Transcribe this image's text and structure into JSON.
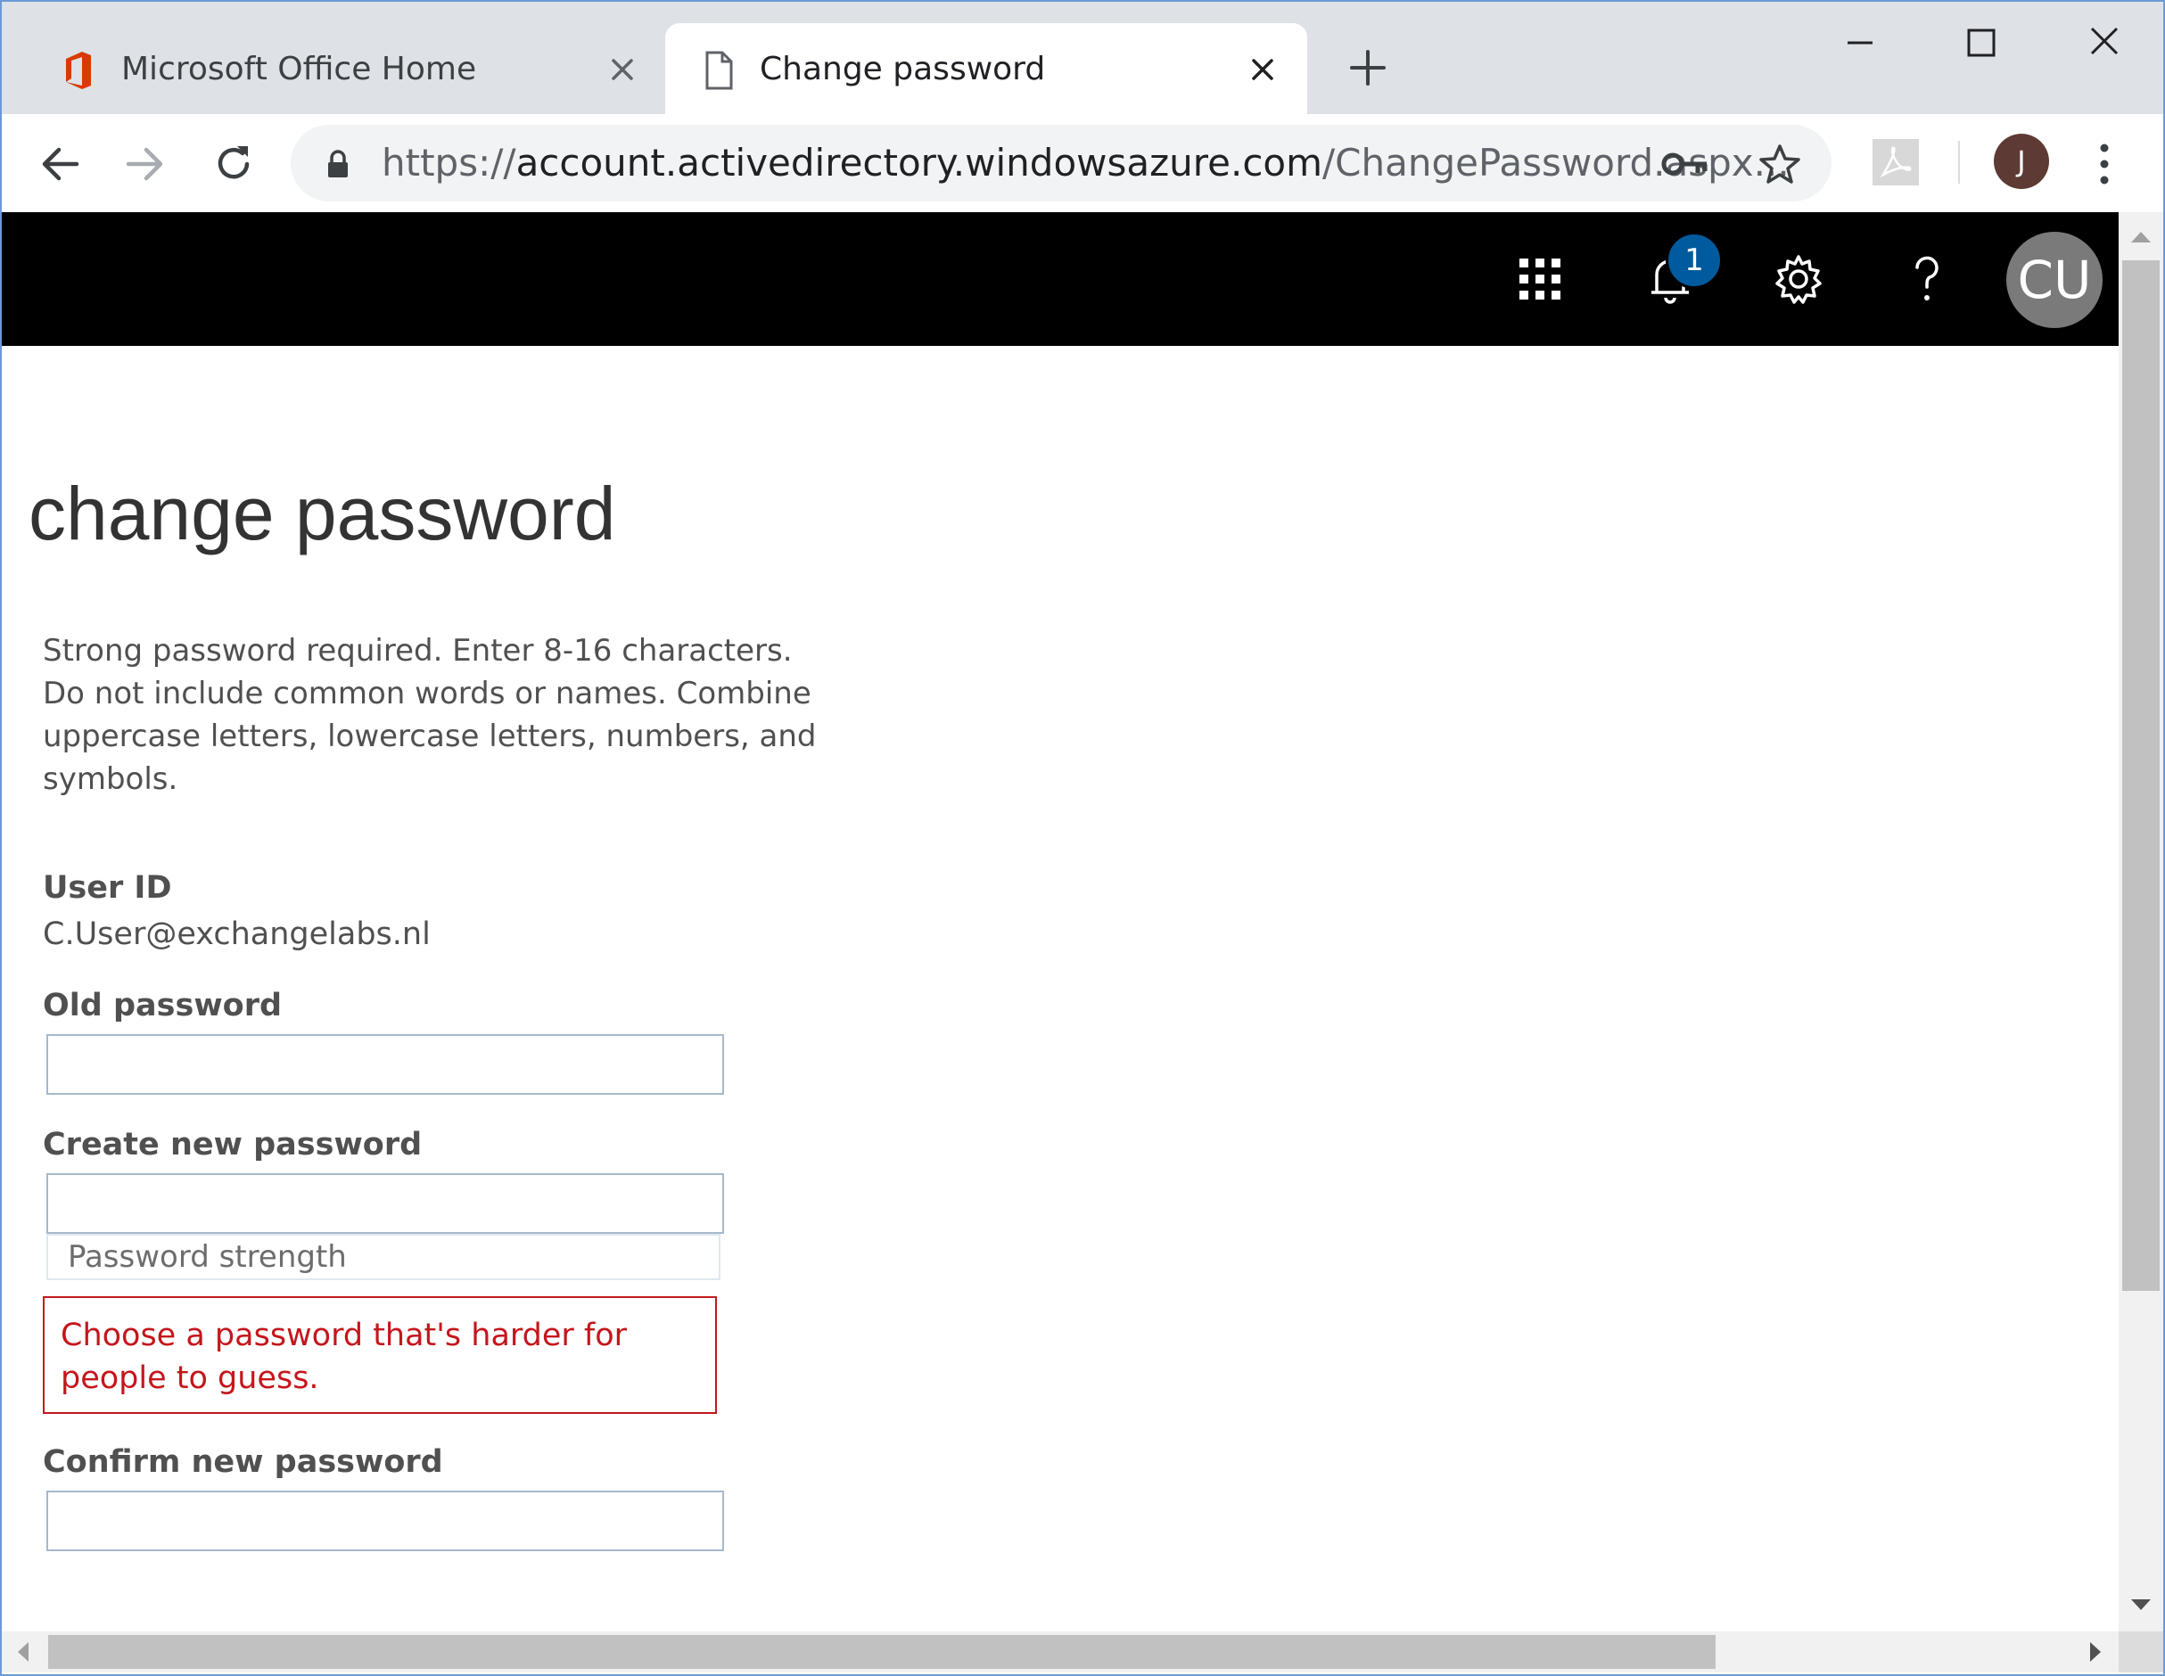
{
  "browser": {
    "tabs": [
      {
        "title": "Microsoft Office Home",
        "active": false
      },
      {
        "title": "Change password",
        "active": true
      }
    ],
    "url_scheme": "https://",
    "url_host": "account.activedirectory.windowsazure.com",
    "url_path": "/ChangePassword.aspx...",
    "profile_initial": "J"
  },
  "o365": {
    "notification_count": "1",
    "user_initials": "CU"
  },
  "page": {
    "title": "change password",
    "instructions": "Strong password required. Enter 8-16 characters. Do not include common words or names. Combine uppercase letters, lowercase letters, numbers, and symbols.",
    "user_id_label": "User ID",
    "user_id_value": "C.User@exchangelabs.nl",
    "old_password_label": "Old password",
    "new_password_label": "Create new password",
    "strength_placeholder": "Password strength",
    "error_message": "Choose a password that's harder for people to guess.",
    "confirm_password_label": "Confirm new password"
  },
  "colors": {
    "office_orange": "#d83b01",
    "error_red": "#c4161c",
    "badge_blue": "#005a9e"
  }
}
